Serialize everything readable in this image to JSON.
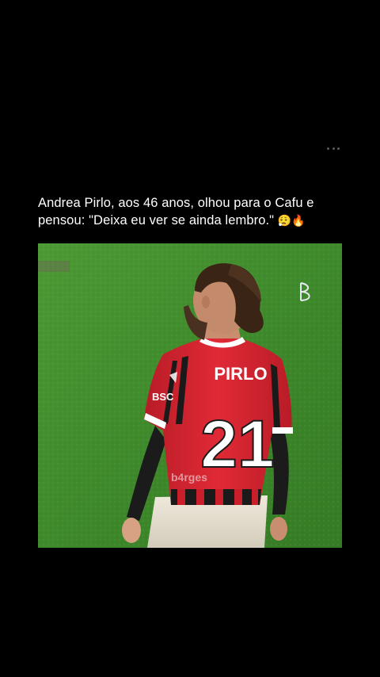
{
  "post": {
    "caption": "Andrea Pirlo, aos 46 anos, olhou para o Cafu e pensou: \"Deixa eu ver se ainda lembro.\"",
    "caption_emojis": "😮‍💨🔥",
    "more_icon": "more-horizontal-icon"
  },
  "media": {
    "jersey_name": "PIRLO",
    "jersey_number": "21",
    "watermark": "b4rges",
    "corner_mark": "B",
    "colors": {
      "pitch": "#3f8a2c",
      "jersey_red": "#d8232f",
      "jersey_black": "#1a1a1a",
      "shorts": "#e6e0d2"
    }
  }
}
